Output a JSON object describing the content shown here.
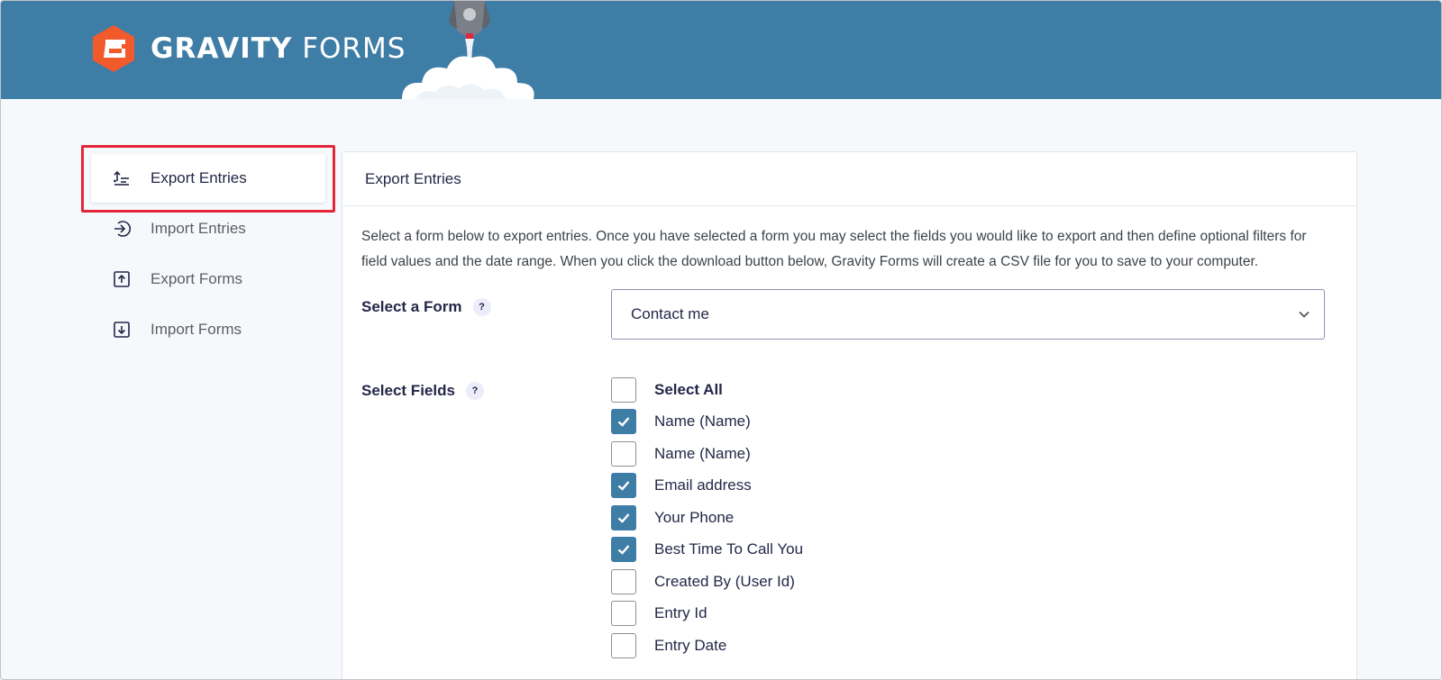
{
  "brand": {
    "name_strong": "GRAVITY",
    "name_light": "FORMS",
    "color_header": "#3e7da6",
    "color_logo": "#f15a2b"
  },
  "sidebar": {
    "items": [
      {
        "label": "Export Entries",
        "icon": "export-entries-icon",
        "active": true
      },
      {
        "label": "Import Entries",
        "icon": "import-entries-icon",
        "active": false
      },
      {
        "label": "Export Forms",
        "icon": "export-forms-icon",
        "active": false
      },
      {
        "label": "Import Forms",
        "icon": "import-forms-icon",
        "active": false
      }
    ]
  },
  "panel": {
    "title": "Export Entries",
    "description": "Select a form below to export entries. Once you have selected a form you may select the fields you would like to export and then define optional filters for field values and the date range. When you click the download button below, Gravity Forms will create a CSV file for you to save to your computer.",
    "form_select": {
      "label": "Select a Form",
      "help": "?",
      "value": "Contact me"
    },
    "fields": {
      "label": "Select Fields",
      "help": "?",
      "items": [
        {
          "label": "Select All",
          "checked": false
        },
        {
          "label": "Name (Name)",
          "checked": true
        },
        {
          "label": "Name (Name)",
          "checked": false
        },
        {
          "label": "Email address",
          "checked": true
        },
        {
          "label": "Your Phone",
          "checked": true
        },
        {
          "label": "Best Time To Call You",
          "checked": true
        },
        {
          "label": "Created By (User Id)",
          "checked": false
        },
        {
          "label": "Entry Id",
          "checked": false
        },
        {
          "label": "Entry Date",
          "checked": false
        }
      ]
    }
  }
}
